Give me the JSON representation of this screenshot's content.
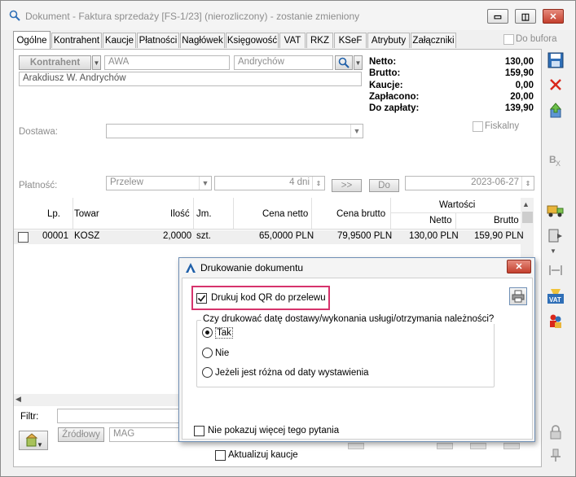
{
  "window": {
    "title": "Dokument - Faktura sprzedaży [FS-1/23] (nierozliczony) - zostanie zmieniony",
    "minimize_glyph": "▭",
    "maximize_glyph": "◫",
    "close_glyph": "✕"
  },
  "tabs": [
    "Ogólne",
    "Kontrahent",
    "Kaucje",
    "Płatności",
    "Nagłówek",
    "Księgowość",
    "VAT",
    "RKZ",
    "KSeF",
    "Atrybuty",
    "Załączniki"
  ],
  "do_bufora_label": "Do bufora",
  "contractor": {
    "button_label": "Kontrahent",
    "code": "AWA",
    "name_short": "Andrychów",
    "full_name": "Arakdiusz W. Andrychów"
  },
  "summary": [
    {
      "label": "Netto:",
      "value": "130,00"
    },
    {
      "label": "Brutto:",
      "value": "159,90"
    },
    {
      "label": "Kaucje:",
      "value": "0,00"
    },
    {
      "label": "Zapłacono:",
      "value": "20,00"
    },
    {
      "label": "Do zapłaty:",
      "value": "139,90"
    }
  ],
  "dostawa_label": "Dostawa:",
  "fiskalny_label": "Fiskalny",
  "payment": {
    "label": "Płatność:",
    "method": "Przelew",
    "days": "4 dni",
    "forward_label": ">>",
    "do_label": "Do",
    "date": "2023-06-27"
  },
  "grid": {
    "headers": {
      "lp": "Lp.",
      "towar": "Towar",
      "ilosc": "Ilość",
      "jm": "Jm.",
      "cena_netto": "Cena netto",
      "cena_brutto": "Cena brutto",
      "wartosci": "Wartości",
      "netto": "Netto",
      "brutto": "Brutto"
    },
    "rows": [
      {
        "lp": "00001",
        "towar": "KOSZ",
        "ilosc": "2,0000",
        "jm": "szt.",
        "cena_netto": "65,0000 PLN",
        "cena_brutto": "79,9500 PLN",
        "netto": "130,00 PLN",
        "brutto": "159,90 PLN"
      }
    ]
  },
  "bottom": {
    "filter_label": "Filtr:",
    "source_label": "Źródłowy",
    "warehouse": "MAG",
    "update_deposits_label": "Aktualizuj kaucje"
  },
  "dialog": {
    "title": "Drukowanie dokumentu",
    "qr_label": "Drukuj kod QR do przelewu",
    "question": "Czy drukować datę dostawy/wykonania usługi/otrzymania należności?",
    "options": [
      "Tak",
      "Nie",
      "Jeżeli jest różna od daty wystawienia"
    ],
    "dont_show_label": "Nie pokazuj więcej tego pytania"
  },
  "colors": {
    "highlight": "#d6336c",
    "accent": "#1f5fa8",
    "close": "#c4402e"
  }
}
